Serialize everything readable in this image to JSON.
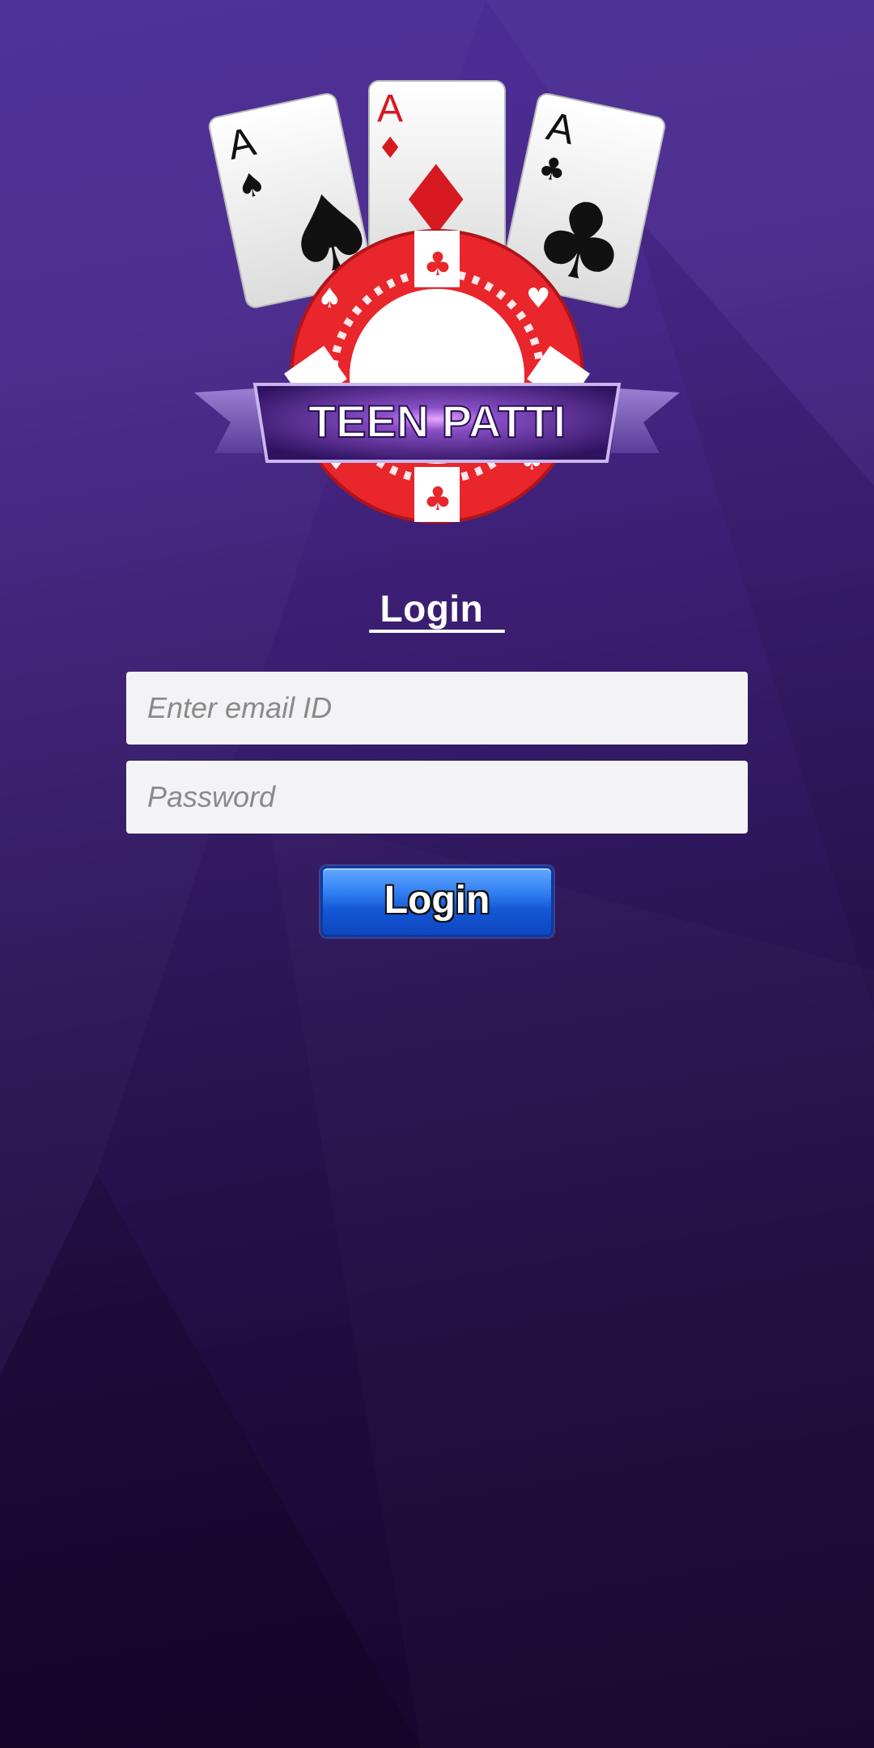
{
  "logo": {
    "banner_text": "TEEN PATTI",
    "card_rank": "A",
    "suits": [
      "spade",
      "diamond",
      "club"
    ]
  },
  "login": {
    "title": " Login  ",
    "email_placeholder": "Enter email ID",
    "password_placeholder": "Password",
    "button_label": "Login"
  },
  "colors": {
    "background_top": "#4a2e96",
    "background_bottom": "#14062a",
    "chip_red": "#e8262b",
    "banner_purple": "#3d1f6e",
    "button_blue": "#1a5fdc"
  }
}
